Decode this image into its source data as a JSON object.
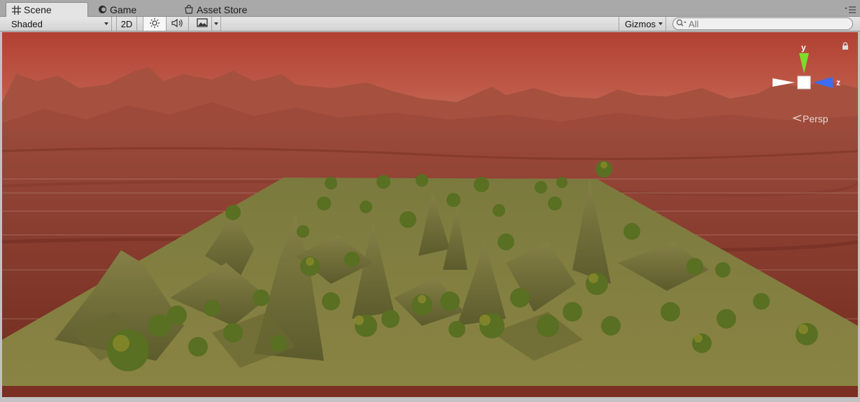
{
  "tabs": [
    {
      "label": "Scene",
      "icon": "grid-icon",
      "active": true
    },
    {
      "label": "Game",
      "icon": "game-icon",
      "active": false
    },
    {
      "label": "Asset Store",
      "icon": "store-icon",
      "active": false
    }
  ],
  "toolbar": {
    "draw_mode": "Shaded",
    "mode_2d": "2D",
    "gizmos_label": "Gizmos",
    "search_placeholder": "All"
  },
  "viewport": {
    "projection_label": "Persp",
    "axes": {
      "y": "y",
      "z": "z"
    },
    "colors": {
      "y_axis": "#7ddc2a",
      "z_axis": "#3d6cf0",
      "sky": "#b84a3a",
      "ground": "#8b3b2a",
      "terrain": "#7d7a3c"
    }
  }
}
